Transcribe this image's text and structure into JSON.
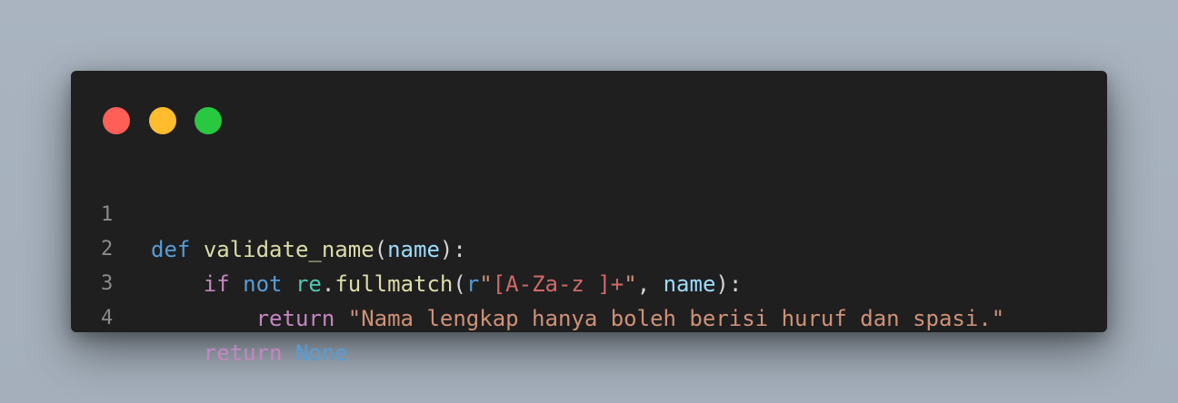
{
  "window": {
    "buttons": [
      {
        "name": "close",
        "color": "#ff5f57"
      },
      {
        "name": "minimize",
        "color": "#ffbd2e"
      },
      {
        "name": "maximize",
        "color": "#28c840"
      }
    ]
  },
  "code": {
    "language": "python",
    "lines": [
      {
        "number": "1",
        "tokens": [
          {
            "text": "def",
            "kind": "keyword"
          },
          {
            "text": " ",
            "kind": "space"
          },
          {
            "text": "validate_name",
            "kind": "function"
          },
          {
            "text": "(",
            "kind": "punct"
          },
          {
            "text": "name",
            "kind": "param"
          },
          {
            "text": "):",
            "kind": "punct"
          }
        ]
      },
      {
        "number": "2",
        "tokens": [
          {
            "text": "    ",
            "kind": "space"
          },
          {
            "text": "if",
            "kind": "control"
          },
          {
            "text": " ",
            "kind": "space"
          },
          {
            "text": "not",
            "kind": "keyword"
          },
          {
            "text": " ",
            "kind": "space"
          },
          {
            "text": "re",
            "kind": "module"
          },
          {
            "text": ".",
            "kind": "punct"
          },
          {
            "text": "fullmatch",
            "kind": "function"
          },
          {
            "text": "(",
            "kind": "punct"
          },
          {
            "text": "r",
            "kind": "keyword"
          },
          {
            "text": "\"",
            "kind": "string"
          },
          {
            "text": "[A-Za-z ]+",
            "kind": "regex"
          },
          {
            "text": "\"",
            "kind": "string"
          },
          {
            "text": ", ",
            "kind": "punct"
          },
          {
            "text": "name",
            "kind": "param"
          },
          {
            "text": "):",
            "kind": "punct"
          }
        ]
      },
      {
        "number": "3",
        "tokens": [
          {
            "text": "        ",
            "kind": "space"
          },
          {
            "text": "return",
            "kind": "control"
          },
          {
            "text": " ",
            "kind": "space"
          },
          {
            "text": "\"Nama lengkap hanya boleh berisi huruf dan spasi.\"",
            "kind": "string"
          }
        ]
      },
      {
        "number": "4",
        "tokens": [
          {
            "text": "    ",
            "kind": "space"
          },
          {
            "text": "return",
            "kind": "control"
          },
          {
            "text": " ",
            "kind": "space"
          },
          {
            "text": "None",
            "kind": "keyword"
          }
        ]
      }
    ]
  },
  "colors": {
    "background": "#a6b1bd",
    "editor": "#1f1f1f",
    "line_number": "#8b8b8b",
    "keyword": "#569cd6",
    "control": "#c586c0",
    "function": "#dcdcaa",
    "param": "#9cdcfe",
    "module": "#4ec9b0",
    "string": "#ce9178",
    "regex": "#d16969",
    "punct": "#d4d4d4"
  }
}
